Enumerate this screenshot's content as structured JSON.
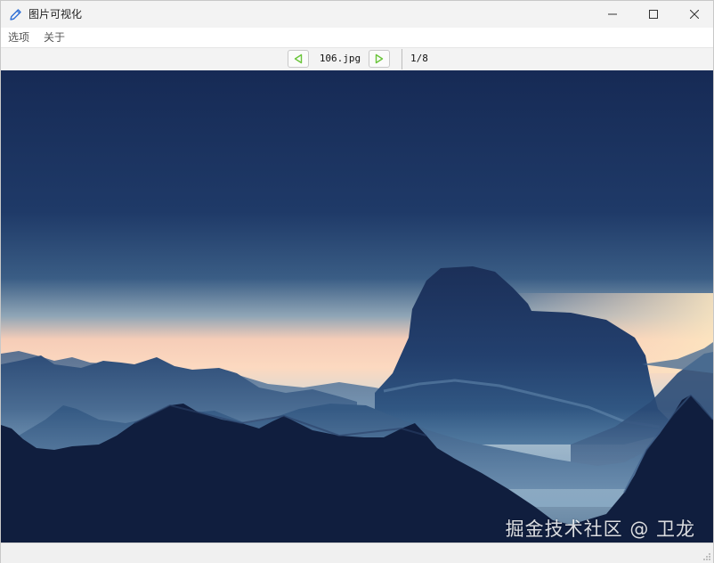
{
  "window": {
    "title": "图片可视化",
    "minimize_icon": "minimize-icon",
    "maximize_icon": "maximize-icon",
    "close_icon": "close-icon",
    "app_icon": "pen-edit-icon"
  },
  "menu": {
    "items": [
      {
        "label": "选项"
      },
      {
        "label": "关于"
      }
    ]
  },
  "toolbar": {
    "prev_icon": "triangle-left-icon",
    "next_icon": "triangle-right-icon",
    "file_name": "106.jpg",
    "page_counter": "1/8",
    "accent_color": "#6ac53a"
  },
  "image": {
    "description_tag": "mountain-dusk-landscape",
    "watermark": "掘金技术社区 @ 卫龙",
    "sky_top_color": "#1a2f5a",
    "horizon_color": "#fcd2bd",
    "mountain_color": "#0f1d3d"
  }
}
